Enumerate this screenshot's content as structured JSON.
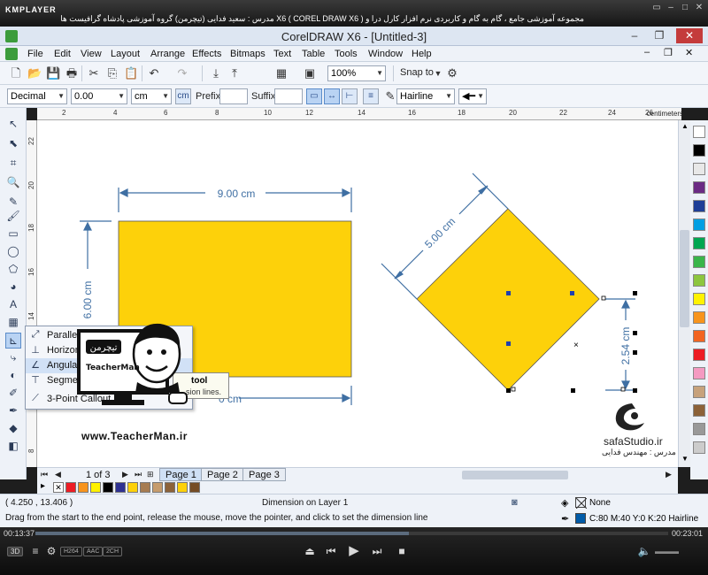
{
  "kmplayer": {
    "logo": "KMPLAYER",
    "title": "مجموعه آموزشی جامع ، گام به گام و کاربردی نرم افزار کارل درا و  X6 ( COREL DRAW X6 )  مدرس : سعید فدایی (تیچرمن) گروه آموزشی پادشاه گرافیست ها",
    "time_elapsed": "00:13:37",
    "time_total": "00:23:01",
    "progress": 0.59,
    "chips": [
      "3D",
      "H264",
      "AAC",
      "2CH"
    ]
  },
  "window": {
    "title": "CorelDRAW X6 - [Untitled-3]",
    "minimize_icon": "minimize-icon",
    "restore_icon": "restore-icon",
    "close_label": "✕"
  },
  "menu": {
    "items": [
      "File",
      "Edit",
      "View",
      "Layout",
      "Arrange",
      "Effects",
      "Bitmaps",
      "Text",
      "Table",
      "Tools",
      "Window",
      "Help"
    ]
  },
  "toolbar": {
    "zoom_value": "100%",
    "snap_label": "Snap to"
  },
  "property_bar": {
    "style_value": "Decimal",
    "precision_value": "0.00",
    "units_value": "cm",
    "prefix_label": "Prefix:",
    "suffix_label": "Suffix:",
    "outline_value": "Hairline"
  },
  "ruler": {
    "units": "centimeters",
    "ticks": [
      "2",
      "4",
      "6",
      "8",
      "10",
      "12",
      "14",
      "16",
      "18",
      "20",
      "22",
      "24",
      "26",
      "28"
    ],
    "v_ticks": [
      "22",
      "20",
      "18",
      "16",
      "14",
      "12",
      "10",
      "8"
    ]
  },
  "flyout": {
    "items": [
      "Parallel Dimension",
      "Horizontal",
      "Angular",
      "Segment",
      "3-Point Callout"
    ],
    "selected": 2
  },
  "tooltip": {
    "title": "tool",
    "desc": "sion lines."
  },
  "canvas": {
    "rect_width_label": "9.00 cm",
    "rect_height_label": "6.00 cm",
    "rect_bottom_label": "0 cm",
    "diamond_side_label": "5.00 cm",
    "diamond_vertical_label": "2.54 cm",
    "fill_color": "#FDD10A",
    "dimension_color": "#3F6FA3"
  },
  "watermarks": {
    "teacherman_logo_text": "تیچرمن",
    "teacherman_name": "TeacherMan",
    "teacherman_url": "www.TeacherMan.ir",
    "safa_name": "safaStudio.ir",
    "safa_teacher": "مدرس : مهندس فدایی"
  },
  "pages": {
    "count_text": "1 of 3",
    "tabs": [
      "Page 1",
      "Page 2",
      "Page 3"
    ],
    "active": 0
  },
  "palette": {
    "colors": [
      "#ffffff",
      "#000000",
      "#e8e8e8",
      "#6b2b84",
      "#1f3f97",
      "#009fe3",
      "#00a651",
      "#39b54a",
      "#8dc63f",
      "#fff200",
      "#f7941d",
      "#f26522",
      "#ed1c24",
      "#f49ac1",
      "#c7a27c",
      "#8c6239",
      "#999999",
      "#cccccc"
    ],
    "doc_colors": [
      "#ed1c24",
      "#f7941d",
      "#fff200",
      "#000000",
      "#2e3192",
      "#fdd10a",
      "#a67c52",
      "#c69c6d",
      "#8c6239",
      "#fdd10a",
      "#754c24"
    ]
  },
  "status": {
    "coords": "( 4.250 , 13.406 )",
    "layer": "Dimension on Layer 1",
    "hint": "Drag from the start to the end point, release the mouse, move the pointer, and click to set the dimension line",
    "fill_label": "None",
    "outline_label": "C:80 M:40 Y:0 K:20  Hairline"
  }
}
